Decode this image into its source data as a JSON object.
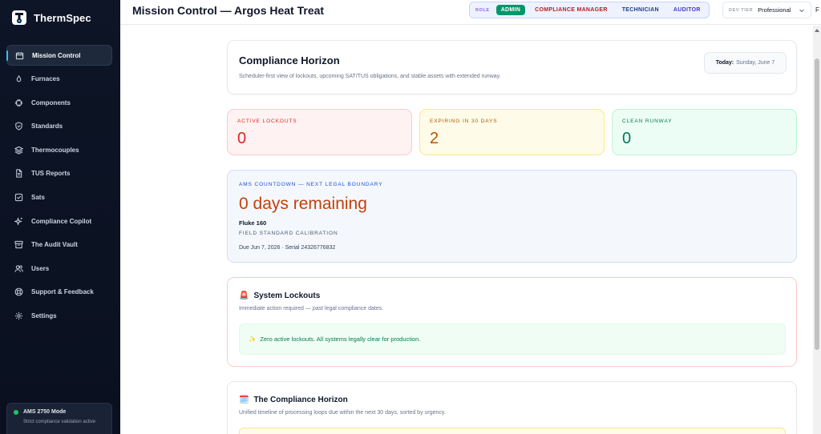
{
  "app": {
    "name": "ThermSpec"
  },
  "sidebar": {
    "items": [
      {
        "label": "Mission Control",
        "icon": "calendar-icon"
      },
      {
        "label": "Furnaces",
        "icon": "flame-icon"
      },
      {
        "label": "Components",
        "icon": "cpu-icon"
      },
      {
        "label": "Standards",
        "icon": "shield-icon"
      },
      {
        "label": "Thermocouples",
        "icon": "layers-icon"
      },
      {
        "label": "TUS Reports",
        "icon": "document-icon"
      },
      {
        "label": "Sats",
        "icon": "checkbox-icon"
      },
      {
        "label": "Compliance Copilot",
        "icon": "sparkles-icon"
      },
      {
        "label": "The Audit Vault",
        "icon": "archive-icon"
      },
      {
        "label": "Users",
        "icon": "users-icon"
      },
      {
        "label": "Support & Feedback",
        "icon": "support-icon"
      },
      {
        "label": "Settings",
        "icon": "gear-icon"
      }
    ],
    "ams": {
      "title": "AMS 2750 Mode",
      "subtitle": "Strict compliance validation active"
    }
  },
  "header": {
    "title": "Mission Control — Argos Heat Treat",
    "role_label": "ROLE",
    "roles": [
      "ADMIN",
      "COMPLIANCE MANAGER",
      "TECHNICIAN",
      "AUDITOR"
    ],
    "tier_label": "DEV TIER",
    "tier_value": "Professional",
    "edge_letter": "F"
  },
  "horizon": {
    "title": "Compliance Horizon",
    "subtitle": "Scheduler-first view of lockouts, upcoming SAT/TUS obligations, and stable assets with extended runway.",
    "today_label": "Today:",
    "today_value": "Sunday, June 7"
  },
  "stats": {
    "lockouts": {
      "label": "ACTIVE LOCKOUTS",
      "value": "0"
    },
    "expiring": {
      "label": "EXPIRING IN 30 DAYS",
      "value": "2"
    },
    "runway": {
      "label": "CLEAN RUNWAY",
      "value": "0"
    }
  },
  "ams_countdown": {
    "kicker": "AMS COUNTDOWN — NEXT LEGAL BOUNDARY",
    "days": "0 days remaining",
    "device": "Fluke 160",
    "classification": "FIELD STANDARD CALIBRATION",
    "due": "Due Jun 7, 2026 · Serial 24326776832"
  },
  "lockouts_section": {
    "icon": "🚨",
    "title": "System Lockouts",
    "subtitle": "Immediate action required — past legal compliance dates.",
    "clear_icon": "✨",
    "clear_message": "Zero active lockouts. All systems legally clear for production."
  },
  "timeline_section": {
    "icon": "🗓️",
    "title": "The Compliance Horizon",
    "subtitle": "Unified timeline of processing loops due within the next 30 days, sorted by urgency."
  },
  "colors": {
    "sidebar_bg": "#0d1526",
    "accent_admin": "#059669",
    "lockout_red": "#dc2626",
    "expiring_amber": "#b45309",
    "runway_green": "#047857",
    "countdown_orange": "#c2410c"
  }
}
